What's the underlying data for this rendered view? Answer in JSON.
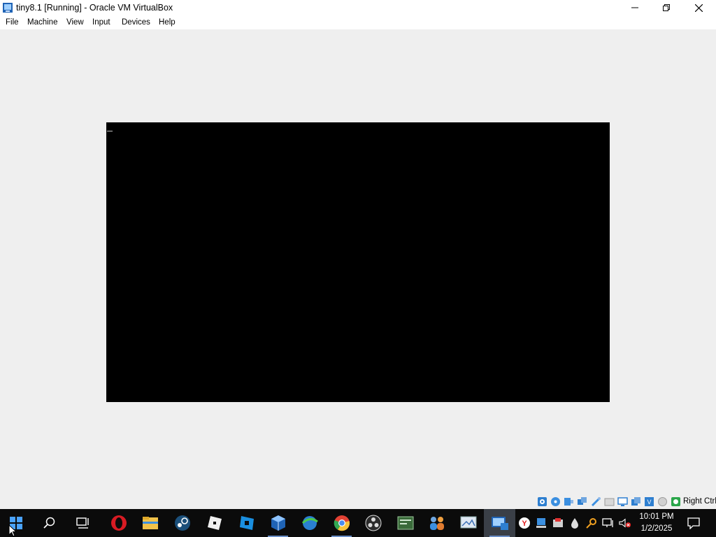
{
  "window": {
    "title": "tiny8.1 [Running] - Oracle VM VirtualBox",
    "icon": "virtualbox-app-icon",
    "controls": [
      "minimize-icon",
      "restore-icon",
      "close-icon"
    ]
  },
  "menubar": {
    "items": [
      {
        "label": "File"
      },
      {
        "label": "Machine"
      },
      {
        "label": "View"
      },
      {
        "label": "Input"
      },
      {
        "label": "Devices"
      },
      {
        "label": "Help"
      }
    ]
  },
  "vm": {
    "screen_color": "#000000",
    "cursor_visible": true
  },
  "statusbar": {
    "icons": [
      "hard-disk-icon",
      "optical-drive-icon",
      "audio-icon",
      "network-icon",
      "usb-icon",
      "shared-folders-icon",
      "display-icon",
      "video-capture-icon",
      "recording-icon",
      "virtualization-icon",
      "mouse-integration-icon",
      "host-key-indicator-icon"
    ],
    "host_key": "Right Ctrl"
  },
  "taskbar": {
    "apps": [
      "windows-start-icon",
      "search-icon",
      "task-view-icon",
      "opera-icon",
      "file-explorer-icon",
      "steam-icon",
      "roblox-icon",
      "roblox-studio-icon",
      "virtualbox-icon",
      "internet-download-manager-icon",
      "chrome-icon",
      "obs-icon",
      "terminal-icon",
      "people-app-icon",
      "snipping-icon",
      "virtualbox-running-icon"
    ],
    "tray_icons": [
      "yandex-icon",
      "network-drive-icon",
      "defender-icon",
      "droplet-icon",
      "key-icon",
      "network-icon",
      "volume-muted-icon"
    ],
    "clock": {
      "time": "10:01 PM",
      "date": "1/2/2025"
    },
    "notifications_icon": "action-center-icon"
  },
  "colors": {
    "titlebar_bg": "#ffffff",
    "client_bg": "#efefef",
    "taskbar_bg": "#0b0b0b",
    "accent": "#6b8fc7"
  }
}
